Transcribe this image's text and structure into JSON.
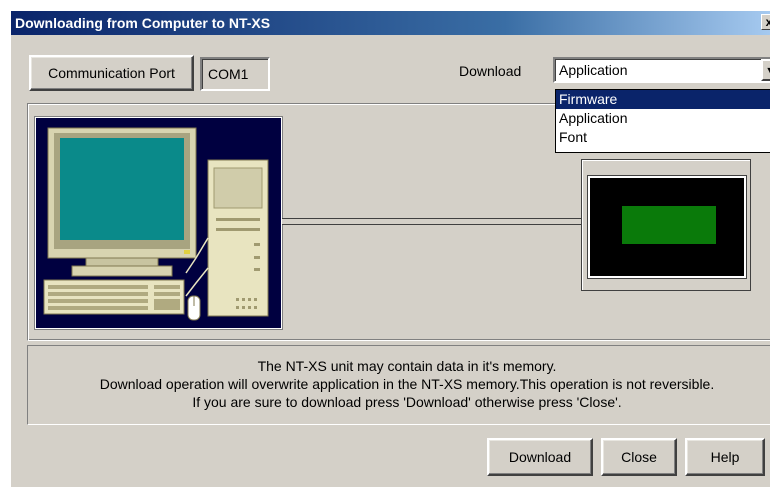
{
  "window": {
    "title": "Downloading from Computer to NT-XS",
    "close_glyph": "x"
  },
  "top": {
    "comm_port_label": "Communication Port",
    "comm_port_value": "COM1",
    "download_label": "Download",
    "download_selected": "Application",
    "dropdown_options": [
      "Firmware",
      "Application",
      "Font"
    ],
    "highlighted_option": "Firmware"
  },
  "message": {
    "line1": "The NT-XS unit may contain data in it's memory.",
    "line2": "Download operation will overwrite application in the NT-XS memory.This operation is not reversible.",
    "line3": "If you are sure to download press 'Download' otherwise press 'Close'."
  },
  "buttons": {
    "download": "Download",
    "close": "Close",
    "help": "Help"
  },
  "colors": {
    "title_start": "#0a246a",
    "title_end": "#a6caf0",
    "pc_background": "#000040",
    "monitor_screen": "#0a8a8a",
    "device_display": "#0a7a0a"
  },
  "icons": {
    "dropdown": "chevron-down-icon",
    "computer": "computer-illustration",
    "device": "nt-xs-device-illustration"
  }
}
